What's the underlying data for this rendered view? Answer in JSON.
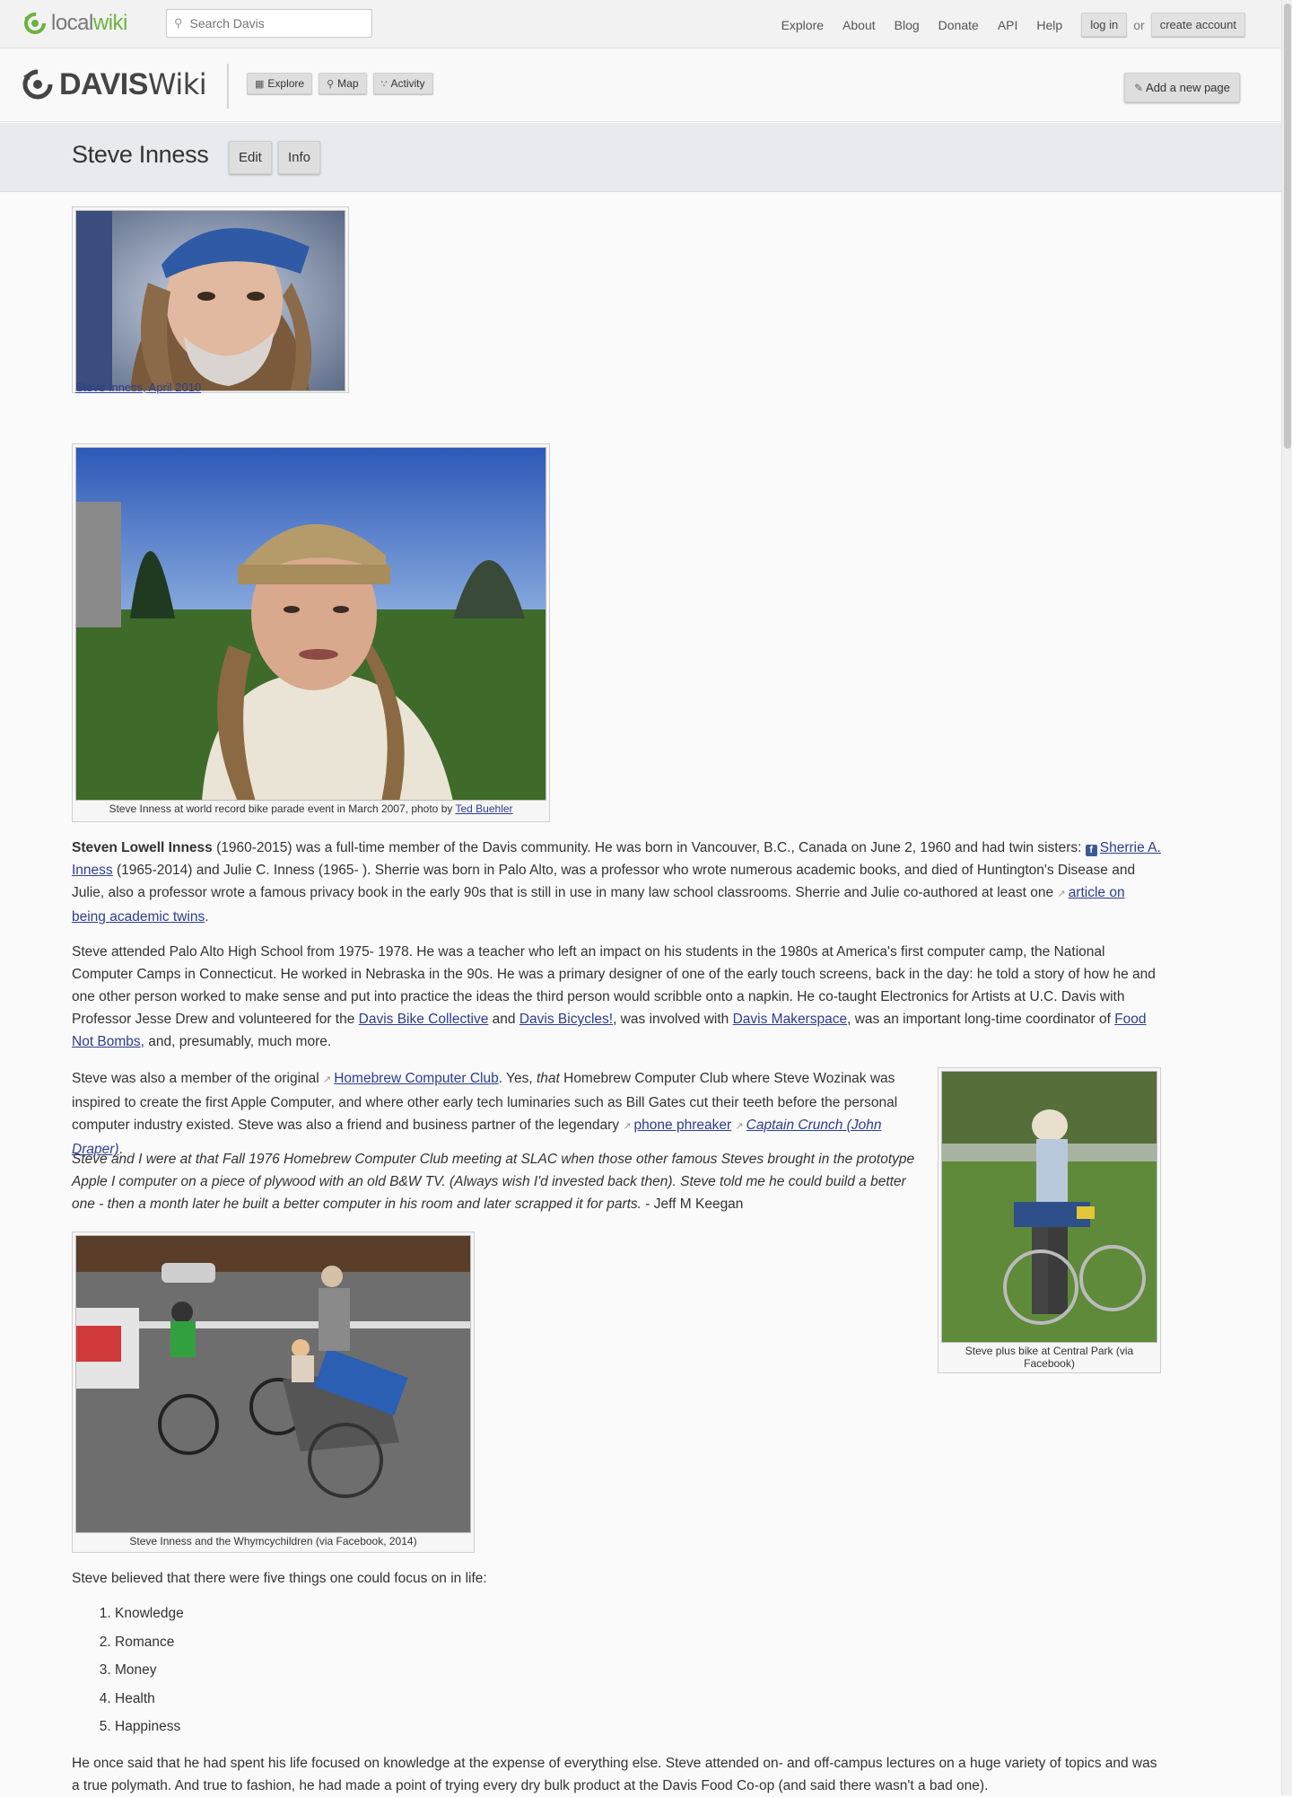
{
  "topbar": {
    "logo_part1": "local",
    "logo_part2": "wiki",
    "search_placeholder": "Search Davis",
    "nav": [
      "Explore",
      "About",
      "Blog",
      "Donate",
      "API",
      "Help"
    ],
    "login": "log in",
    "or": "or",
    "create_account": "create account"
  },
  "header": {
    "logo_bold": "DAVIS",
    "logo_light": "Wiki",
    "buttons": [
      "Explore",
      "Map",
      "Activity"
    ],
    "add_page": "Add a new page"
  },
  "page": {
    "title": "Steve Inness",
    "edit": "Edit",
    "info": "Info"
  },
  "figures": {
    "f1_caption": "Steve Inness, April 2010",
    "f2_caption_text": "Steve Inness at world record bike parade event in March 2007, photo by ",
    "f2_caption_link": "Ted Buehler",
    "f3_caption": "Steve plus bike at Central Park (via Facebook)",
    "f4_caption": "Steve Inness and the Whymcychildren (via Facebook, 2014)"
  },
  "p1": {
    "name": "Steven Lowell Inness",
    "t1": " (1960-2015) was a full-time member of the Davis community.  He was born in Vancouver, B.C., Canada on June 2, 1960 and had twin sisters: ",
    "link1": "Sherrie A. Inness",
    "t2": " (1965-2014) and Julie C. Inness (1965- ). Sherrie was born in Palo Alto, was a professor who wrote numerous academic books, and died of Huntington's Disease and Julie, also a professor wrote a famous privacy book in the early 90s that is still in use in many law school classrooms.   Sherrie and Julie co-authored at least one ",
    "link2": "article on being academic twins",
    "t3": "."
  },
  "p2": {
    "t1": "Steve attended Palo Alto High School from 1975- 1978. He was a teacher who left an impact on his students in the 1980s at America's first computer camp, the National Computer Camps in Connecticut.  He worked in Nebraska in the 90s.  He was a primary designer of one of the early touch screens, back in the day: he told a story of how he and one other person worked to make sense and put into practice the ideas the third person would scribble onto a napkin.  He co-taught Electronics for Artists at U.C. Davis with Professor Jesse Drew and volunteered for the ",
    "link1": "Davis Bike Collective",
    "t2": " and ",
    "link2": "Davis Bicycles!",
    "t3": ", was involved with  ",
    "link3": "Davis Makerspace",
    "t4": ", was an important long-time coordinator of ",
    "link4": "Food Not Bombs",
    "t5": ", and, presumably, much more."
  },
  "p3": {
    "t1": "Steve was also a member of the original ",
    "link1": "Homebrew Computer Club",
    "t2": ". Yes, ",
    "em": "that",
    "t3": " Homebrew Computer Club where Steve Wozinak was inspired to create the first Apple Computer, and where other early tech luminaries such as Bill Gates cut their teeth before the personal computer industry existed.  Steve was also a friend and business partner of the legendary ",
    "link2": "phone phreaker",
    "link3": "Captain Crunch (John Draper)",
    "t4": "."
  },
  "p4": {
    "quote": "Steve and I were at that Fall 1976 Homebrew Computer Club meeting at SLAC when those other famous Steves brought in the prototype Apple I computer on a piece of plywood with an old B&W TV. (Always wish I'd invested back then). Steve told me he could build a better one - then a month later he built a better computer in his room and later scrapped it for parts.",
    "attribution": " - Jeff M Keegan"
  },
  "p5": "Steve believed that there were five things one could focus on in life:",
  "five_things": [
    "Knowledge",
    "Romance",
    "Money",
    "Health",
    "Happiness"
  ],
  "p6": "He once said that he had spent his life focused on knowledge at the expense of everything else.  Steve attended on- and off-campus lectures on a huge variety of topics and was a true polymath.  And true to fashion, he had made a point of trying every dry bulk product at the Davis Food Co-op (and said there wasn't a bad one).",
  "colors": {
    "link": "#2d3e8e",
    "brand_green": "#6cb33f",
    "facebook": "#3b5998"
  }
}
